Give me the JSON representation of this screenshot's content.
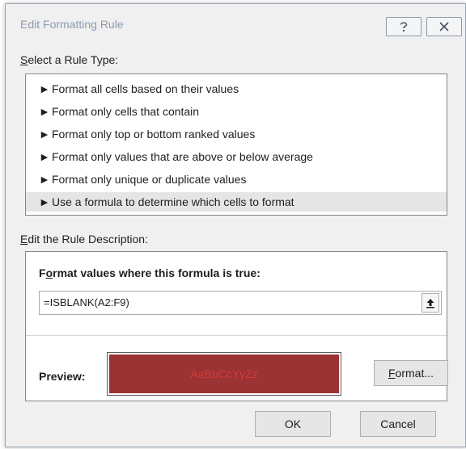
{
  "dialog": {
    "title": "Edit Formatting Rule",
    "help_icon": "help-icon",
    "close_icon": "close-icon"
  },
  "rule_type": {
    "label_mnemonic": "S",
    "label_rest": "elect a Rule Type:",
    "items": [
      {
        "label": "Format all cells based on their values",
        "selected": false
      },
      {
        "label": "Format only cells that contain",
        "selected": false
      },
      {
        "label": "Format only top or bottom ranked values",
        "selected": false
      },
      {
        "label": "Format only values that are above or below average",
        "selected": false
      },
      {
        "label": "Format only unique or duplicate values",
        "selected": false
      },
      {
        "label": "Use a formula to determine which cells to format",
        "selected": true
      }
    ],
    "bullet": "►"
  },
  "description": {
    "label_mnemonic": "E",
    "label_rest": "dit the Rule Description:",
    "formula_label_pre": "F",
    "formula_label_mnemonic": "o",
    "formula_label_rest": "rmat values where this formula is true:",
    "formula_value": "=ISBLANK(A2:F9)",
    "preview_label": "Preview:",
    "preview_text": "AaBbCcYyZz",
    "format_mnemonic": "F",
    "format_rest": "ormat..."
  },
  "buttons": {
    "ok": "OK",
    "cancel": "Cancel"
  },
  "colors": {
    "preview_fill": "#9b3233",
    "preview_text": "#d23c3c",
    "selected_row": "#e5e5e5"
  }
}
